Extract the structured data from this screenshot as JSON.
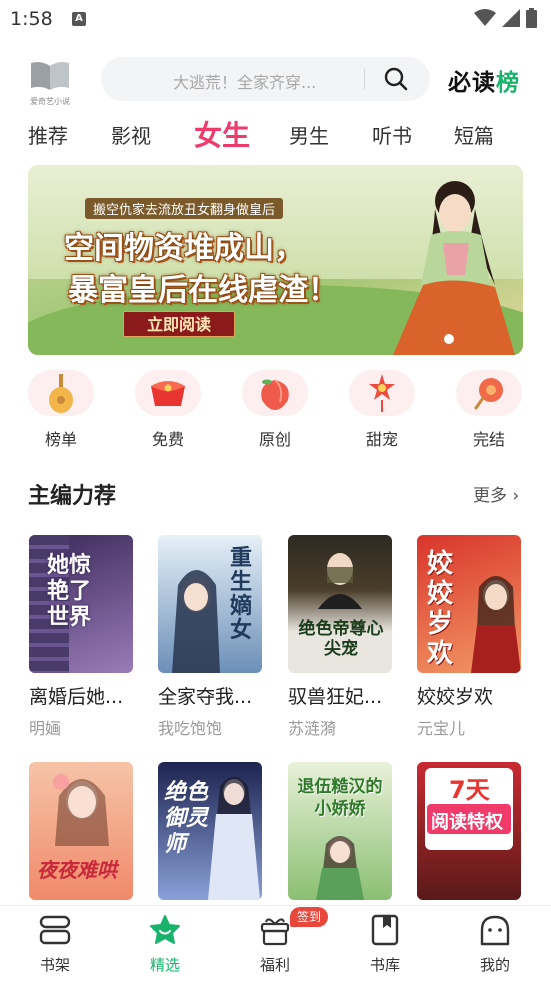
{
  "status_bar": {
    "time": "1:58",
    "notification_glyph": "A"
  },
  "header": {
    "logo_text": "爱奇艺小说",
    "search_placeholder": "大逃荒！全家齐穿...",
    "brand_prefix": "必读",
    "brand_suffix": "榜"
  },
  "tabs": [
    {
      "label": "推荐",
      "active": false
    },
    {
      "label": "影视",
      "active": false
    },
    {
      "label": "女生",
      "active": true
    },
    {
      "label": "男生",
      "active": false
    },
    {
      "label": "听书",
      "active": false
    },
    {
      "label": "短篇",
      "active": false
    }
  ],
  "banner": {
    "subtitle": "搬空仇家去流放丑女翻身做皇后",
    "title_line1": "空间物资堆成山，",
    "title_line2": "暴富皇后在线虐渣！",
    "cta": "立即阅读"
  },
  "quick_entries": [
    {
      "label": "榜单",
      "icon": "lute-icon"
    },
    {
      "label": "免费",
      "icon": "red-envelope-icon"
    },
    {
      "label": "原创",
      "icon": "peach-icon"
    },
    {
      "label": "甜宠",
      "icon": "lantern-icon"
    },
    {
      "label": "完结",
      "icon": "fan-icon"
    }
  ],
  "section": {
    "title": "主编力荐",
    "more": "更多 ›"
  },
  "books": [
    {
      "name": "离婚后她...",
      "author": "明婳",
      "cover_text": "她惊艳了世界",
      "color_a": "#3b2a5a",
      "color_b": "#9a7bb8",
      "text_color": "#ffffff"
    },
    {
      "name": "全家夺我...",
      "author": "我吃饱饱",
      "cover_text": "重生嫡女",
      "color_a": "#cfe3f3",
      "color_b": "#6c8fb8",
      "text_color": "#1f3a5c"
    },
    {
      "name": "驭兽狂妃...",
      "author": "苏涟漪",
      "cover_text": "绝色帝尊心尖宠",
      "color_a": "#2e2a22",
      "color_b": "#e9e6df",
      "text_color": "#1b3c1b"
    },
    {
      "name": "姣姣岁欢",
      "author": "元宝儿",
      "cover_text": "姣姣岁欢",
      "color_a": "#d9352b",
      "color_b": "#f29a66",
      "text_color": "#ffffff"
    },
    {
      "name": "",
      "author": "",
      "cover_text": "夜夜难哄",
      "color_a": "#f6c4a8",
      "color_b": "#f08a6a",
      "text_color": "#c8283a"
    },
    {
      "name": "",
      "author": "",
      "cover_text": "绝色御灵师",
      "color_a": "#1d2450",
      "color_b": "#8aa0d8",
      "text_color": "#ffffff"
    },
    {
      "name": "",
      "author": "",
      "cover_text": "退伍糙汉的小娇娇",
      "color_a": "#e8f1d8",
      "color_b": "#8bbf73",
      "text_color": "#2f7a2a"
    },
    {
      "name": "",
      "author": "",
      "cover_text": "7天",
      "cover_text2": "阅读特权",
      "color_a": "#c92a30",
      "color_b": "#5a1a1a",
      "text_color": "#ffffff"
    }
  ],
  "bottom_nav": [
    {
      "label": "书架",
      "icon": "bookshelf-icon",
      "active": false
    },
    {
      "label": "精选",
      "icon": "star-icon",
      "active": true
    },
    {
      "label": "福利",
      "icon": "gift-icon",
      "active": false
    },
    {
      "label": "书库",
      "icon": "book-library-icon",
      "active": false
    },
    {
      "label": "我的",
      "icon": "profile-icon",
      "active": false
    }
  ],
  "sign_badge": "签到",
  "colors": {
    "accent_pink": "#ee3b6c",
    "accent_green": "#19b36b",
    "badge_red": "#e8473c"
  }
}
